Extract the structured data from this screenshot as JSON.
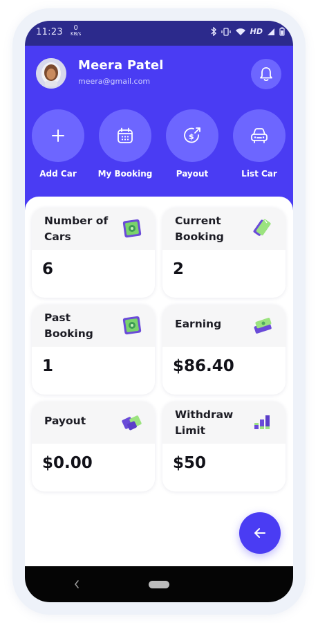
{
  "status_bar": {
    "time": "11:23",
    "speed": "0",
    "speed_unit": "KB/s",
    "network": "HD"
  },
  "user": {
    "name": "Meera Patel",
    "email": "meera@gmail.com"
  },
  "actions": [
    {
      "label": "Add Car",
      "icon": "plus-icon"
    },
    {
      "label": "My Booking",
      "icon": "calendar-icon"
    },
    {
      "label": "Payout",
      "icon": "dollar-arrow-icon"
    },
    {
      "label": "List Car",
      "icon": "car-icon"
    }
  ],
  "cards": [
    {
      "title_line1": "Number of",
      "title_line2": "Cars",
      "value": "6",
      "icon": "safe-icon"
    },
    {
      "title_line1": "Current",
      "title_line2": "Booking",
      "value": "2",
      "icon": "cash-stack-icon"
    },
    {
      "title_line1": "Past",
      "title_line2": "Booking",
      "value": "1",
      "icon": "safe-icon"
    },
    {
      "title_line1": "Earning",
      "title_line2": "",
      "value": "$86.40",
      "icon": "money-icon"
    },
    {
      "title_line1": "Payout",
      "title_line2": "",
      "value": "$0.00",
      "icon": "banknotes-icon"
    },
    {
      "title_line1": "Withdraw",
      "title_line2": "Limit",
      "value": "$50",
      "icon": "bar-chart-icon"
    }
  ],
  "colors": {
    "primary": "#4a3cf3",
    "action_circle": "#6d66ff",
    "status_bar": "#2c2a8c",
    "card_header": "#f6f6f7"
  }
}
